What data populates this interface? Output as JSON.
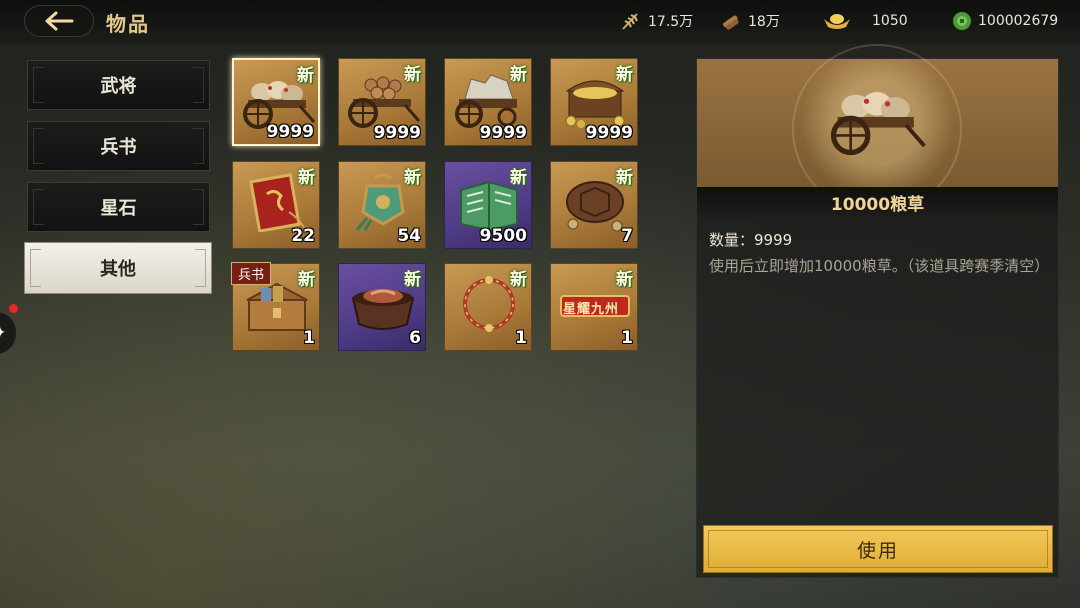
{
  "header": {
    "title": "物品",
    "resources": [
      {
        "icon": "grain-icon",
        "value": "17.5万"
      },
      {
        "icon": "wood-icon",
        "value": "18万"
      },
      {
        "icon": "gold-ingot-icon",
        "value": "1050"
      },
      {
        "icon": "jade-coin-icon",
        "value": "100002679"
      }
    ]
  },
  "tabs": [
    {
      "label": "武将",
      "active": false
    },
    {
      "label": "兵书",
      "active": false
    },
    {
      "label": "星石",
      "active": false
    },
    {
      "label": "其他",
      "active": true
    }
  ],
  "items": [
    {
      "name": "grain-cart",
      "new_label": "新",
      "count": "9999",
      "rarity": "gold",
      "selected": true
    },
    {
      "name": "wood-cart",
      "new_label": "新",
      "count": "9999",
      "rarity": "gold"
    },
    {
      "name": "stone-cart",
      "new_label": "新",
      "count": "9999",
      "rarity": "gold"
    },
    {
      "name": "coin-chest",
      "new_label": "新",
      "count": "9999",
      "rarity": "gold"
    },
    {
      "name": "dragon-token",
      "new_label": "新",
      "count": "22",
      "rarity": "gold"
    },
    {
      "name": "jade-pendant",
      "new_label": "新",
      "count": "54",
      "rarity": "gold"
    },
    {
      "name": "green-book",
      "new_label": "新",
      "count": "9500",
      "rarity": "purple"
    },
    {
      "name": "turtle-shell",
      "new_label": "新",
      "count": "7",
      "rarity": "gold"
    },
    {
      "name": "book-chest",
      "tag": "兵书",
      "new_label": "新",
      "count": "1",
      "rarity": "gold"
    },
    {
      "name": "meat-pot",
      "new_label": "新",
      "count": "6",
      "rarity": "purple"
    },
    {
      "name": "ring-frame",
      "new_label": "新",
      "count": "1",
      "rarity": "gold"
    },
    {
      "name": "title-badge",
      "new_label": "新",
      "count": "1",
      "rarity": "gold",
      "badge_text": "星耀九州"
    }
  ],
  "detail": {
    "name": "10000粮草",
    "quantity_label": "数量：",
    "quantity_value": "9999",
    "description": "使用后立即增加10000粮草。（该道具跨赛季清空）",
    "use_label": "使用"
  }
}
